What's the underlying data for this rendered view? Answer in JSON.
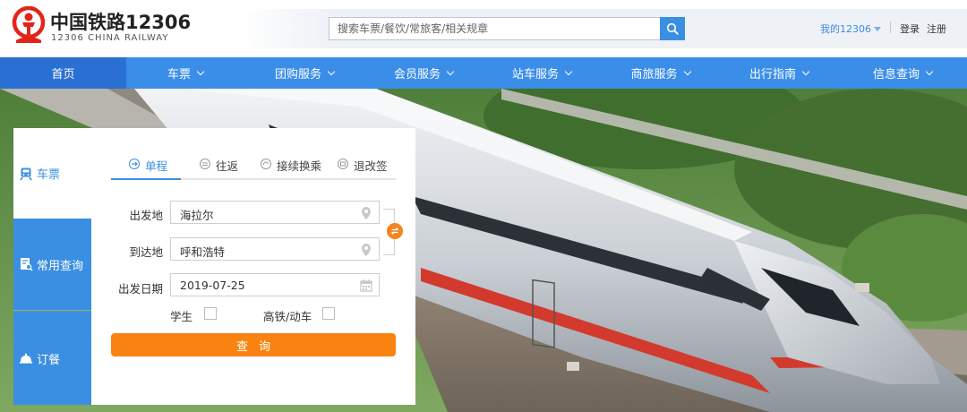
{
  "brand": {
    "name_cn": "中国铁路12306",
    "name_en": "12306 CHINA RAILWAY",
    "color": "#e1251b"
  },
  "search": {
    "placeholder": "搜索车票/餐饮/常旅客/相关规章",
    "icon": "search-icon"
  },
  "account": {
    "my12306": "我的12306",
    "login": "登录",
    "register": "注册"
  },
  "nav": {
    "items": [
      {
        "label": "首页",
        "active": true,
        "has_dropdown": false
      },
      {
        "label": "车票",
        "has_dropdown": true
      },
      {
        "label": "团购服务",
        "has_dropdown": true
      },
      {
        "label": "会员服务",
        "has_dropdown": true
      },
      {
        "label": "站车服务",
        "has_dropdown": true
      },
      {
        "label": "商旅服务",
        "has_dropdown": true
      },
      {
        "label": "出行指南",
        "has_dropdown": true
      },
      {
        "label": "信息查询",
        "has_dropdown": true
      }
    ]
  },
  "side_tabs": [
    {
      "label": "车票",
      "icon": "train-icon",
      "active": true
    },
    {
      "label": "常用查询",
      "icon": "document-search-icon"
    },
    {
      "label": "订餐",
      "icon": "food-cloche-icon"
    }
  ],
  "mode_tabs": [
    {
      "label": "单程",
      "icon": "arrow-right-circle-icon",
      "active": true
    },
    {
      "label": "往返",
      "icon": "round-trip-circle-icon"
    },
    {
      "label": "接续换乘",
      "icon": "transfer-circle-icon"
    },
    {
      "label": "退改签",
      "icon": "refund-circle-icon"
    }
  ],
  "form": {
    "from_label": "出发地",
    "from_value": "海拉尔",
    "to_label": "到达地",
    "to_value": "呼和浩特",
    "date_label": "出发日期",
    "date_value": "2019-07-25",
    "student_label": "学生",
    "student_checked": false,
    "highspeed_label": "高铁/动车",
    "highspeed_checked": false,
    "query_label": "查询"
  },
  "colors": {
    "primary_blue": "#3b8ee8",
    "nav_active": "#2a6fd3",
    "accent_orange": "#f98310"
  }
}
